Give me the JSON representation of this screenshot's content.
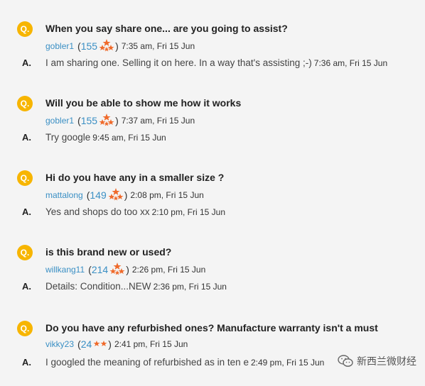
{
  "qa": [
    {
      "badge": "Q.",
      "question": "When you say share one... are you going to assist?",
      "user": "gobler1",
      "open_paren": "(",
      "score": "155",
      "close_paren": ")",
      "q_time": "7:35 am, Fri 15 Jun",
      "a_label": "A.",
      "answer": "I am sharing one. Selling it on here. In a way that's assisting ;-)",
      "a_time": "7:36 am, Fri 15 Jun"
    },
    {
      "badge": "Q.",
      "question": "Will you be able to show me how it works",
      "user": "gobler1",
      "open_paren": "(",
      "score": "155",
      "close_paren": ")",
      "q_time": "7:37 am, Fri 15 Jun",
      "a_label": "A.",
      "answer": "Try google",
      "a_time": "9:45 am, Fri 15 Jun"
    },
    {
      "badge": "Q.",
      "question": "Hi do you have any in a smaller size ?",
      "user": "mattalong",
      "open_paren": "(",
      "score": "149",
      "close_paren": ")",
      "q_time": "2:08 pm, Fri 15 Jun",
      "a_label": "A.",
      "answer": "Yes and shops do too xx",
      "a_time": "2:10 pm, Fri 15 Jun"
    },
    {
      "badge": "Q.",
      "question": "is this brand new or used?",
      "user": "willkang11",
      "open_paren": "(",
      "score": "214",
      "close_paren": ")",
      "q_time": "2:26 pm, Fri 15 Jun",
      "a_label": "A.",
      "answer": "Details: Condition...NEW",
      "a_time": "2:36 pm, Fri 15 Jun"
    },
    {
      "badge": "Q.",
      "question": "Do you have any refurbished ones? Manufacture warranty isn't a must",
      "user": "vikky23",
      "open_paren": "(",
      "score": "24",
      "close_paren": ")",
      "q_time": "2:41 pm, Fri 15 Jun",
      "a_label": "A.",
      "answer": "I googled the meaning of refurbished as in ten e",
      "a_time": "2:49 pm, Fri 15 Jun"
    }
  ],
  "watermark": {
    "text": "新西兰微财经"
  },
  "colors": {
    "badge": "#f7b500",
    "user": "#3a8fc4",
    "star": "#ef6a2b",
    "background": "#f4f4f4"
  },
  "icons": {
    "rating": "star-cluster-icon",
    "watermark": "wechat-icon"
  }
}
